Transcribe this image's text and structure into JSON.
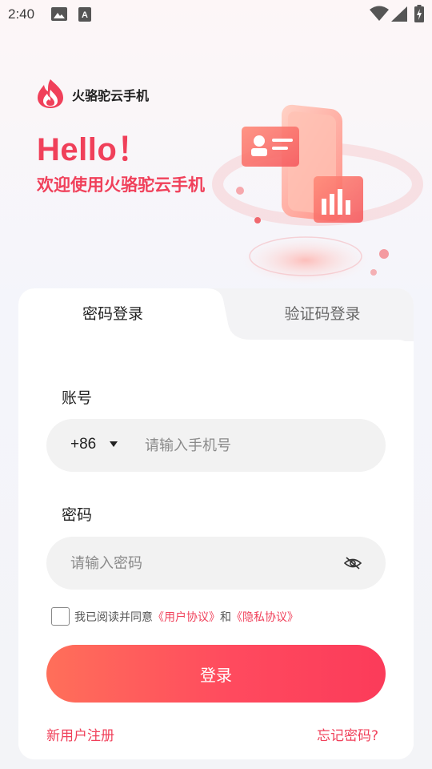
{
  "status_bar": {
    "time": "2:40",
    "icons": [
      "image-icon",
      "a-notification-icon",
      "wifi-icon",
      "signal-icon",
      "battery-charging-icon"
    ]
  },
  "header": {
    "app_name": "火骆驼云手机",
    "hello": "Hello！",
    "welcome": "欢迎使用火骆驼云手机"
  },
  "tabs": [
    {
      "label": "密码登录",
      "active": true
    },
    {
      "label": "验证码登录",
      "active": false
    }
  ],
  "form": {
    "account_label": "账号",
    "country_code": "+86",
    "phone_placeholder": "请输入手机号",
    "password_label": "密码",
    "password_placeholder": "请输入密码"
  },
  "agreement": {
    "prefix": "我已阅读并同意",
    "user_agreement": "《用户协议》",
    "conjunction": "和",
    "privacy_agreement": "《隐私协议》",
    "checked": false
  },
  "login_button": "登录",
  "register_link": "新用户注册",
  "forgot_link": "忘记密码?",
  "colors": {
    "accent": "#f0405a",
    "button_start": "#ff6f5a",
    "button_end": "#fb3b5a",
    "field_bg": "#f2f2f2"
  }
}
